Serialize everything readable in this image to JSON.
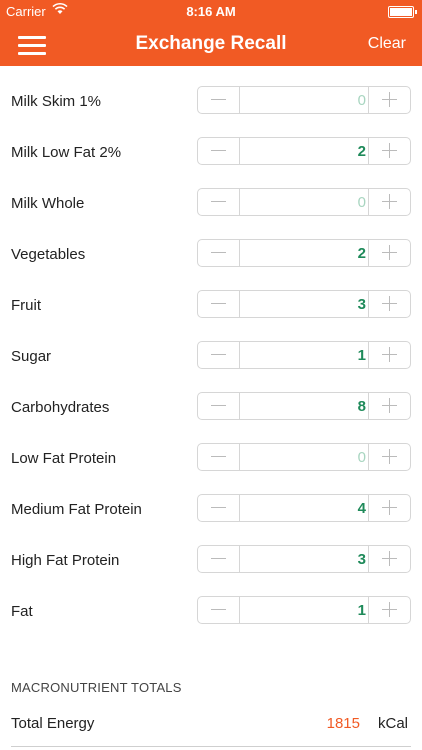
{
  "status_bar": {
    "carrier": "Carrier",
    "time": "8:16 AM"
  },
  "nav": {
    "title": "Exchange Recall",
    "clear_label": "Clear"
  },
  "exchanges": [
    {
      "label": "Milk Skim 1%",
      "value": "0"
    },
    {
      "label": "Milk Low Fat 2%",
      "value": "2"
    },
    {
      "label": "Milk Whole",
      "value": "0"
    },
    {
      "label": "Vegetables",
      "value": "2"
    },
    {
      "label": "Fruit",
      "value": "3"
    },
    {
      "label": "Sugar",
      "value": "1"
    },
    {
      "label": "Carbohydrates",
      "value": "8"
    },
    {
      "label": "Low Fat Protein",
      "value": "0"
    },
    {
      "label": "Medium Fat Protein",
      "value": "4"
    },
    {
      "label": "High Fat Protein",
      "value": "3"
    },
    {
      "label": "Fat",
      "value": "1"
    }
  ],
  "totals": {
    "header": "MACRONUTRIENT TOTALS",
    "energy_label": "Total Energy",
    "energy_value": "1815",
    "energy_unit": "kCal"
  },
  "colors": {
    "accent": "#f15a24",
    "value_green": "#1f8a5a",
    "value_zero": "#a8d5c0"
  },
  "icons": {
    "menu": "hamburger-menu-icon",
    "wifi": "wifi-icon",
    "battery": "battery-icon"
  }
}
